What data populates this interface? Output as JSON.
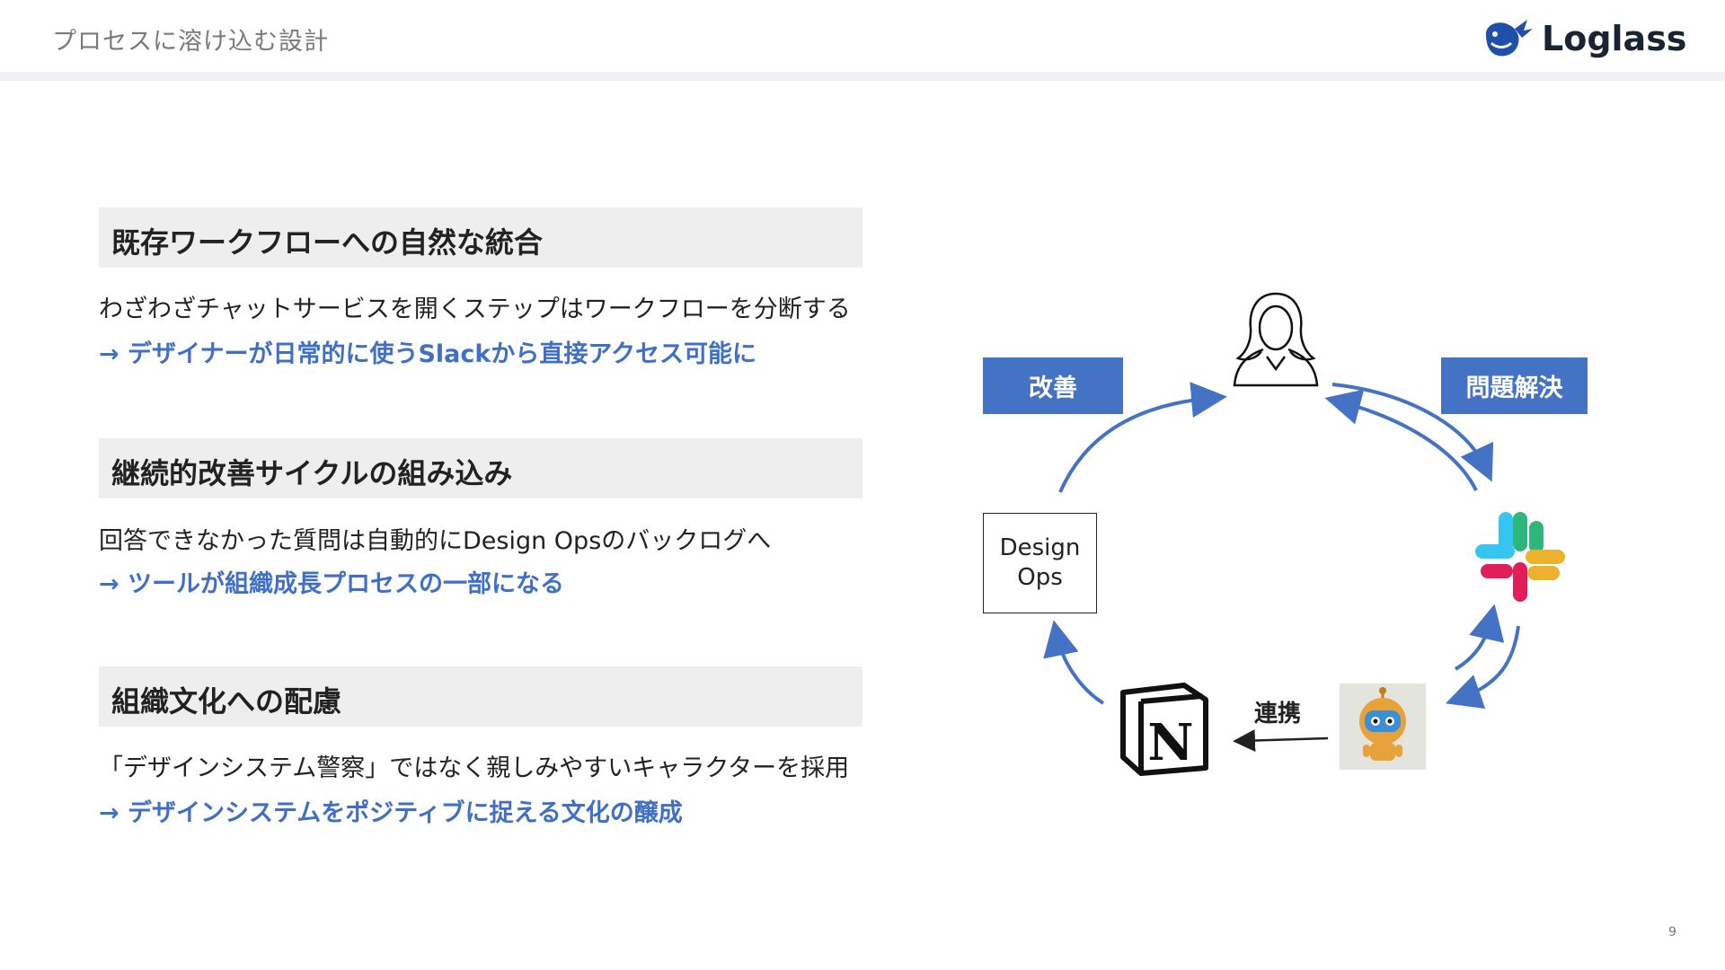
{
  "header": {
    "title": "プロセスに溶け込む設計",
    "logo_text": "Loglass"
  },
  "sections": [
    {
      "title": "既存ワークフローへの自然な統合",
      "body": "わざわざチャットサービスを開くステップはワークフローを分断する",
      "link": "→ デザイナーが日常的に使うSlackから直接アクセス可能に"
    },
    {
      "title": "継続的改善サイクルの組み込み",
      "body": "回答できなかった質問は自動的にDesign Opsのバックログへ",
      "link": "→ ツールが組織成長プロセスの一部になる"
    },
    {
      "title": "組織文化への配慮",
      "body": "「デザインシステム警察」ではなく親しみやすいキャラクターを採用",
      "link": "→ デザインシステムをポジティブに捉える文化の醸成"
    }
  ],
  "diagram": {
    "improve_label": "改善",
    "solve_label": "問題解決",
    "ops_line1": "Design",
    "ops_line2": "Ops",
    "connect_label": "連携",
    "notion_letter": "N",
    "icons": [
      "person-icon",
      "slack-icon",
      "notion-icon",
      "robot-icon"
    ]
  },
  "colors": {
    "accent": "#4472c4",
    "link": "#3f6fc7",
    "section_bg": "#eeeeee",
    "header_bar": "#eef0f4"
  },
  "page_number": "9"
}
